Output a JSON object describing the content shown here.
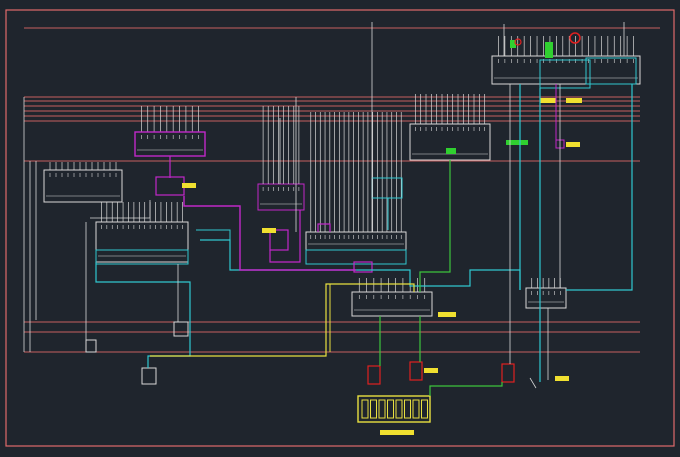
{
  "colors": {
    "background": "#1f252d",
    "border": "#e06a6a",
    "bus": "#c46060",
    "wire_white": "#d8d8d8",
    "wire_magenta": "#c028c8",
    "wire_cyan": "#30c8d0",
    "wire_yellow": "#e8e040",
    "wire_green": "#3cc43c",
    "tag_yellow": "#f0e030",
    "tag_green": "#30d030",
    "marker_red": "#e02020"
  },
  "drawing": {
    "title": "",
    "layers": [
      "bus",
      "wire_white",
      "wire_magenta",
      "wire_cyan",
      "wire_yellow",
      "wire_green"
    ],
    "legible_text": []
  }
}
